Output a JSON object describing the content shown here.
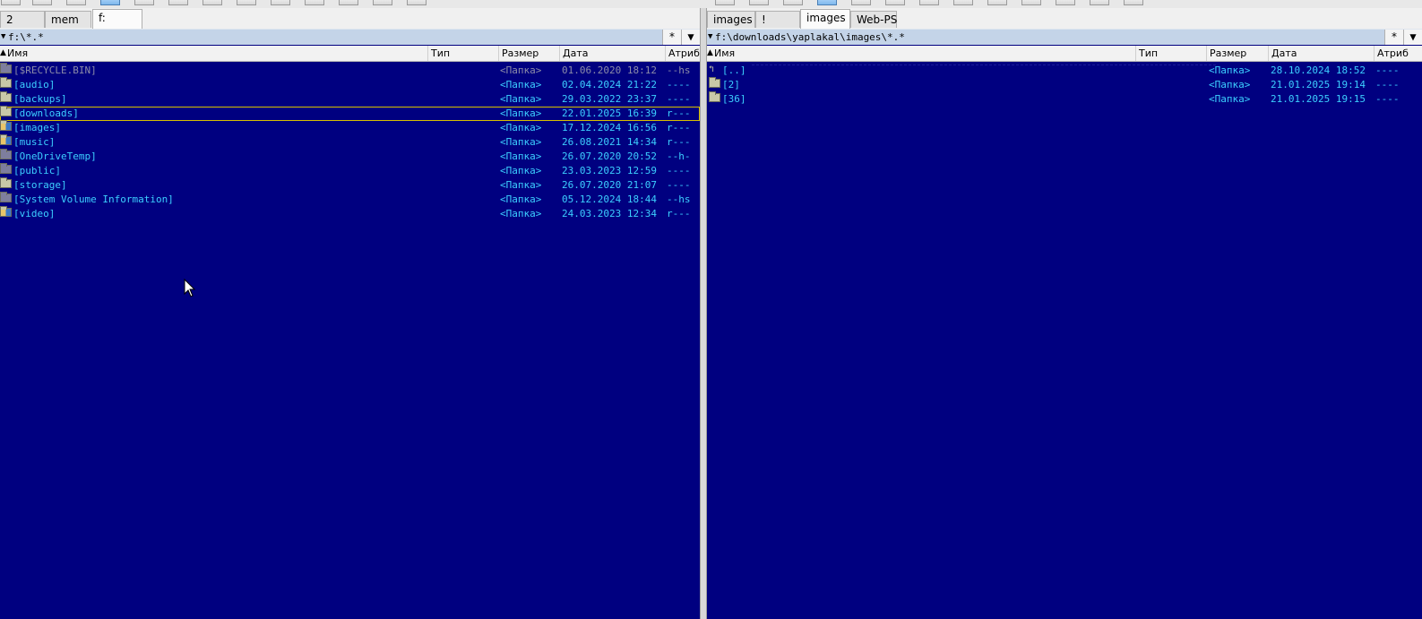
{
  "left_panel": {
    "tabs": [
      {
        "label": "2",
        "active": false
      },
      {
        "label": "mem",
        "active": false
      },
      {
        "label": "f:",
        "active": true
      }
    ],
    "path": "f:\\*.*",
    "filter_symbol": "*",
    "dropdown_symbol": "▼",
    "columns": {
      "name": "Имя",
      "type": "Тип",
      "size": "Размер",
      "date": "Дата",
      "attr": "Атриб"
    },
    "rows": [
      {
        "name": "[$RECYCLE.BIN]",
        "size": "<Папка>",
        "date": "01.06.2020 18:12",
        "attr": "--hs",
        "system": true
      },
      {
        "name": "[audio]",
        "size": "<Папка>",
        "date": "02.04.2024 21:22",
        "attr": "----"
      },
      {
        "name": "[backups]",
        "size": "<Папка>",
        "date": "29.03.2022 23:37",
        "attr": "----"
      },
      {
        "name": "[downloads]",
        "size": "<Папка>",
        "date": "22.01.2025 16:39",
        "attr": "r---",
        "cursor": true
      },
      {
        "name": "[images]",
        "size": "<Папка>",
        "date": "17.12.2024 16:56",
        "attr": "r---",
        "special": true
      },
      {
        "name": "[music]",
        "size": "<Папка>",
        "date": "26.08.2021 14:34",
        "attr": "r---",
        "special": true
      },
      {
        "name": "[OneDriveTemp]",
        "size": "<Папка>",
        "date": "26.07.2020 20:52",
        "attr": "--h-"
      },
      {
        "name": "[public]",
        "size": "<Папка>",
        "date": "23.03.2023 12:59",
        "attr": "----"
      },
      {
        "name": "[storage]",
        "size": "<Папка>",
        "date": "26.07.2020 21:07",
        "attr": "----"
      },
      {
        "name": "[System Volume Information]",
        "size": "<Папка>",
        "date": "05.12.2024 18:44",
        "attr": "--hs"
      },
      {
        "name": "[video]",
        "size": "<Папка>",
        "date": "24.03.2023 12:34",
        "attr": "r---",
        "special": true
      }
    ]
  },
  "right_panel": {
    "tabs": [
      {
        "label": "images",
        "active": false
      },
      {
        "label": "!",
        "active": false
      },
      {
        "label": "images",
        "active": true
      },
      {
        "label": "Web-PS",
        "active": false
      }
    ],
    "path": "f:\\downloads\\yaplakal\\images\\*.*",
    "filter_symbol": "*",
    "dropdown_symbol": "▼",
    "columns": {
      "name": "Имя",
      "type": "Тип",
      "size": "Размер",
      "date": "Дата",
      "attr": "Атриб"
    },
    "rows": [
      {
        "name": "[..]",
        "size": "<Папка>",
        "date": "28.10.2024 18:52",
        "attr": "----",
        "up": true
      },
      {
        "name": "[2]",
        "size": "<Папка>",
        "date": "21.01.2025 19:14",
        "attr": "----"
      },
      {
        "name": "[36]",
        "size": "<Папка>",
        "date": "21.01.2025 19:15",
        "attr": "----"
      }
    ]
  },
  "colors": {
    "panel_bg": "#000080",
    "text": "#3ccfff",
    "system_text": "#8c8ca8",
    "cursor_border": "#d8c000",
    "pathbar_bg": "#c4d4e8"
  }
}
